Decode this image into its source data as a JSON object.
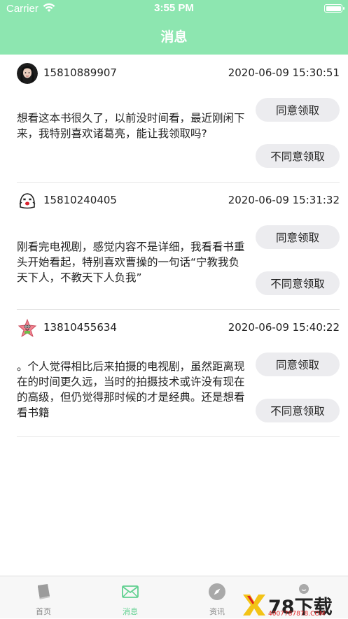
{
  "status_bar": {
    "carrier": "Carrier",
    "time": "3:55 PM"
  },
  "header": {
    "title": "消息"
  },
  "actions": {
    "agree_label": "同意领取",
    "disagree_label": "不同意领取"
  },
  "messages": [
    {
      "phone": "15810889907",
      "datetime": "2020-06-09 15:30:51",
      "content": "想看这本书很久了，以前没时间看，最近刚闲下来，我特别喜欢诸葛亮，能让我领取吗?"
    },
    {
      "phone": "15810240405",
      "datetime": "2020-06-09 15:31:32",
      "content": "刚看完电视剧，感觉内容不是详细，我看看书重头开始看起，特别喜欢曹操的一句话“宁教我负天下人，不教天下人负我”"
    },
    {
      "phone": "13810455634",
      "datetime": "2020-06-09 15:40:22",
      "content": "。个人觉得相比后来拍摄的电视剧，虽然距离现在的时间更久远，当时的拍摄技术或许没有现在的高级，但仍觉得那时候的才是经典。还是想看看书籍"
    }
  ],
  "tabbar": {
    "tabs": [
      {
        "label": "首页",
        "icon": "book-icon"
      },
      {
        "label": "消息",
        "icon": "mail-icon",
        "active": true
      },
      {
        "label": "资讯",
        "icon": "compass-icon"
      },
      {
        "label": "",
        "icon": "profile-icon"
      }
    ]
  },
  "watermark": {
    "brand": "78下载",
    "url": "4007787878.COM"
  },
  "colors": {
    "header_bg": "#8de6b0",
    "active_tab": "#5fd08f",
    "button_bg": "#ececef"
  }
}
